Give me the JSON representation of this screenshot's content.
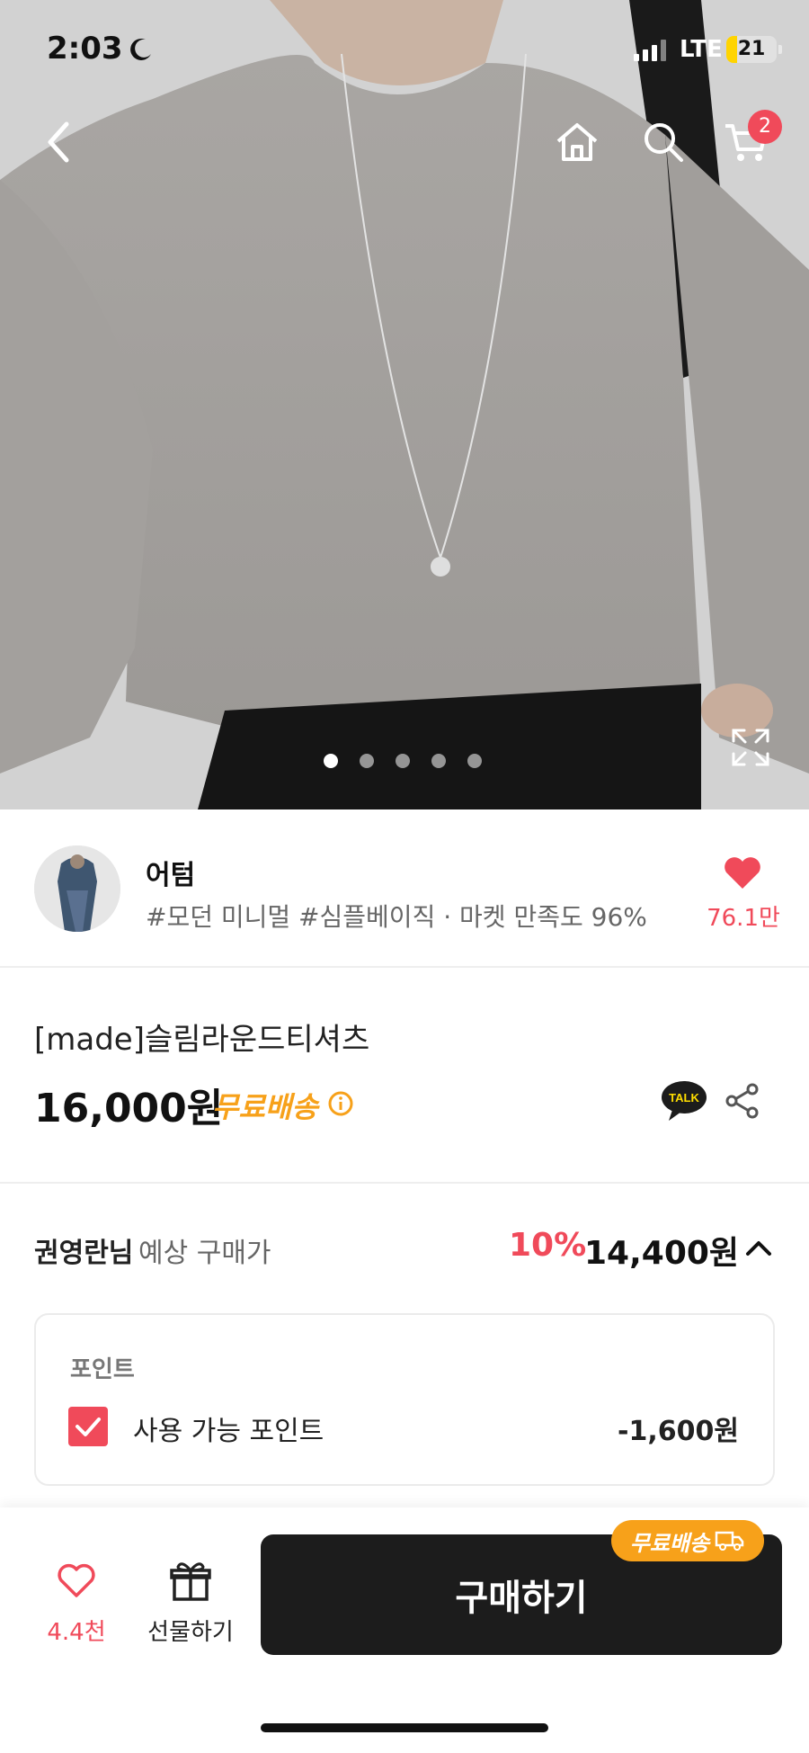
{
  "status": {
    "time": "2:03",
    "network": "LTE",
    "battery": "21",
    "battery_level": 0.21
  },
  "hero": {
    "cart_count": "2",
    "image_count": 5,
    "active_index": 0
  },
  "shop": {
    "name": "어텀",
    "tags": "#모던 미니멀 #심플베이직 · 마켓 만족도 96%",
    "likes": "76.1만"
  },
  "product": {
    "title": "[made]슬림라운드티셔츠",
    "price": "16,000원",
    "free_shipping": "무료배송",
    "talk": "TALK"
  },
  "estimate": {
    "user": "권영란님",
    "label": "예상 구매가",
    "discount": "10%",
    "price": "14,400원"
  },
  "points": {
    "heading": "포인트",
    "label": "사용 가능 포인트",
    "value": "-1,600원"
  },
  "bottom": {
    "wish_count": "4.4천",
    "gift_label": "선물하기",
    "buy_label": "구매하기",
    "badge_label": "무료배송"
  },
  "colors": {
    "accent": "#f04a5a",
    "shipping": "#f7a11a",
    "buy_button": "#1c1c1c"
  }
}
